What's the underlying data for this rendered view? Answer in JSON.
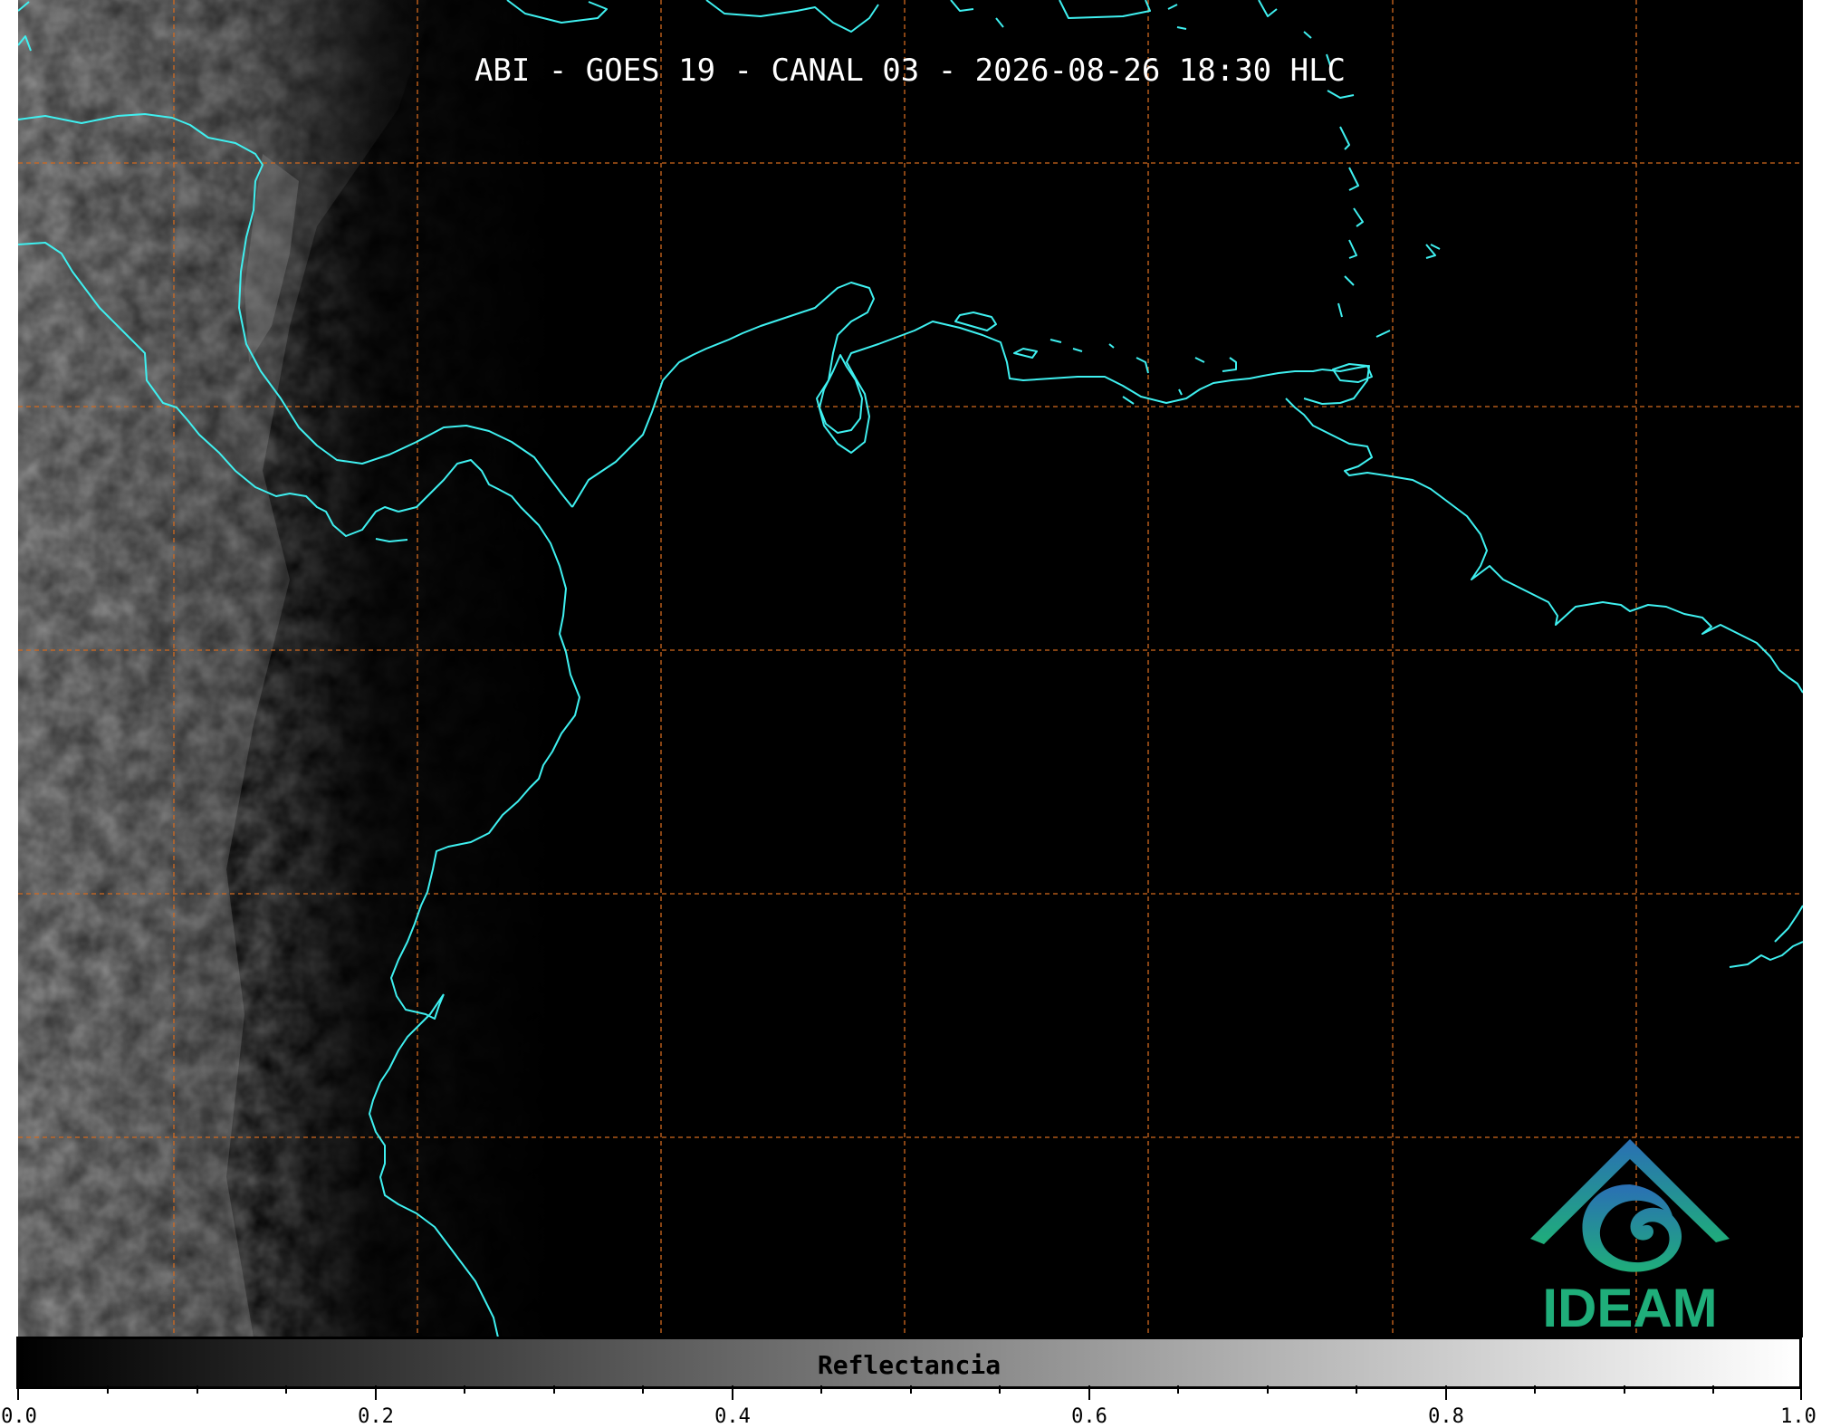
{
  "map": {
    "title": "ABI - GOES 19 - CANAL 03 - 2026-08-26 18:30 HLC",
    "background_color": "#000000",
    "coastline_color": "#3ff0f0",
    "grid_color": "#d2691e",
    "grid_style": "dashed"
  },
  "colorbar": {
    "label": "Reflectancia",
    "min": 0.0,
    "max": 1.0,
    "colormap": "gray",
    "tick_labels": [
      "0.0",
      "0.2",
      "0.4",
      "0.6",
      "0.8",
      "1.0"
    ]
  },
  "logo": {
    "text": "IDEAM",
    "color_top": "#2a6fb5",
    "color_bottom": "#1fae7a"
  }
}
